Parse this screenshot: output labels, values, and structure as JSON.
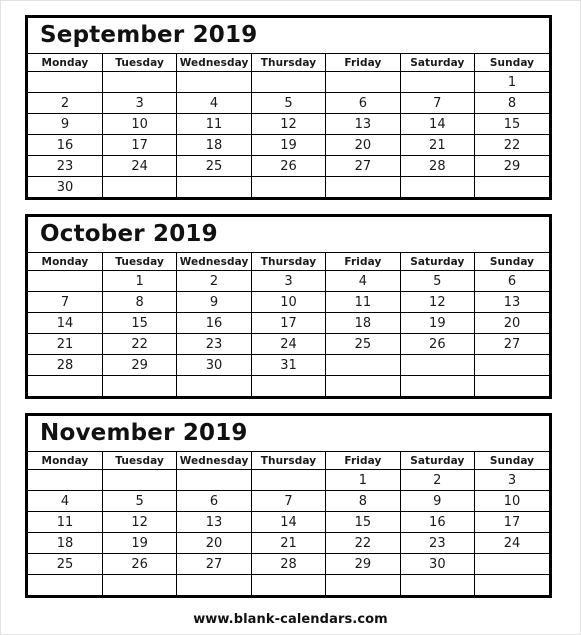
{
  "page": {
    "footer_text": "www.blank-calendars.com",
    "year": "2019",
    "ink_color": "#000000",
    "background_color": "#ffffff"
  },
  "weekday_headers": [
    "Monday",
    "Tuesday",
    "Wednesday",
    "Thursday",
    "Friday",
    "Saturday",
    "Sunday"
  ],
  "months": [
    {
      "title": "September 2019",
      "name": "September",
      "weeks": [
        [
          "",
          "",
          "",
          "",
          "",
          "",
          "1"
        ],
        [
          "2",
          "3",
          "4",
          "5",
          "6",
          "7",
          "8"
        ],
        [
          "9",
          "10",
          "11",
          "12",
          "13",
          "14",
          "15"
        ],
        [
          "16",
          "17",
          "18",
          "19",
          "20",
          "21",
          "22"
        ],
        [
          "23",
          "24",
          "25",
          "26",
          "27",
          "28",
          "29"
        ],
        [
          "30",
          "",
          "",
          "",
          "",
          "",
          ""
        ]
      ]
    },
    {
      "title": "October 2019",
      "name": "October",
      "weeks": [
        [
          "",
          "1",
          "2",
          "3",
          "4",
          "5",
          "6"
        ],
        [
          "7",
          "8",
          "9",
          "10",
          "11",
          "12",
          "13"
        ],
        [
          "14",
          "15",
          "16",
          "17",
          "18",
          "19",
          "20"
        ],
        [
          "21",
          "22",
          "23",
          "24",
          "25",
          "26",
          "27"
        ],
        [
          "28",
          "29",
          "30",
          "31",
          "",
          "",
          ""
        ],
        [
          "",
          "",
          "",
          "",
          "",
          "",
          ""
        ]
      ]
    },
    {
      "title": "November 2019",
      "name": "November",
      "weeks": [
        [
          "",
          "",
          "",
          "",
          "1",
          "2",
          "3"
        ],
        [
          "4",
          "5",
          "6",
          "7",
          "8",
          "9",
          "10"
        ],
        [
          "11",
          "12",
          "13",
          "14",
          "15",
          "16",
          "17"
        ],
        [
          "18",
          "19",
          "20",
          "21",
          "22",
          "23",
          "24"
        ],
        [
          "25",
          "26",
          "27",
          "28",
          "29",
          "30",
          ""
        ],
        [
          "",
          "",
          "",
          "",
          "",
          "",
          ""
        ]
      ]
    }
  ]
}
